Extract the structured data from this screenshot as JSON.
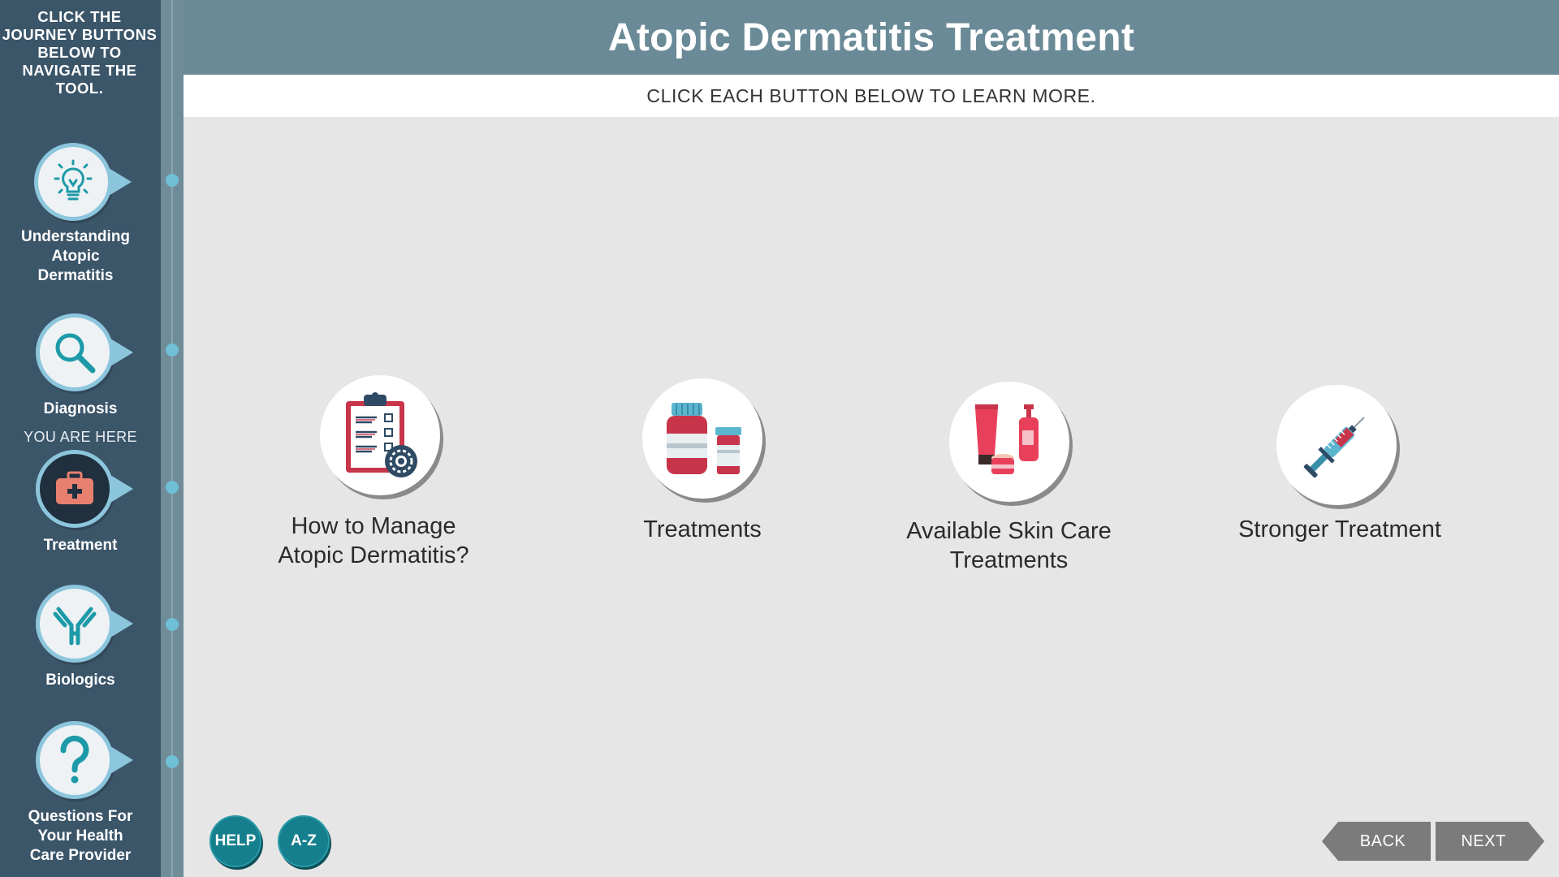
{
  "sidebar": {
    "intro": "CLICK THE JOURNEY BUTTONS BELOW TO NAVIGATE THE TOOL.",
    "you_are_here": "YOU ARE HERE",
    "items": [
      {
        "label_lines": [
          "Understanding",
          "Atopic",
          "Dermatitis"
        ],
        "icon": "lightbulb-icon"
      },
      {
        "label_lines": [
          "Diagnosis"
        ],
        "icon": "magnifier-icon"
      },
      {
        "label_lines": [
          "Treatment"
        ],
        "icon": "medical-kit-icon",
        "active": true
      },
      {
        "label_lines": [
          "Biologics"
        ],
        "icon": "antibody-icon"
      },
      {
        "label_lines": [
          "Questions For",
          "Your Health",
          "Care Provider"
        ],
        "icon": "question-icon"
      }
    ]
  },
  "header": {
    "title": "Atopic Dermatitis Treatment",
    "subtitle": "CLICK EACH BUTTON BELOW TO LEARN MORE."
  },
  "options": [
    {
      "label_lines": [
        "How to Manage",
        "Atopic Dermatitis?"
      ],
      "icon": "clipboard-checklist-icon"
    },
    {
      "label_lines": [
        "Treatments"
      ],
      "icon": "medicine-bottles-icon"
    },
    {
      "label_lines": [
        "Available Skin Care",
        "Treatments"
      ],
      "icon": "skin-care-products-icon"
    },
    {
      "label_lines": [
        "Stronger Treatment"
      ],
      "icon": "syringe-icon"
    }
  ],
  "footer": {
    "help_label": "HELP",
    "az_label": "A-Z",
    "back_label": "BACK",
    "next_label": "NEXT"
  },
  "colors": {
    "sidebar": "#3b5569",
    "header": "#6a8a97",
    "accent": "#157f8d",
    "bubble_border": "#8cc6dd"
  }
}
